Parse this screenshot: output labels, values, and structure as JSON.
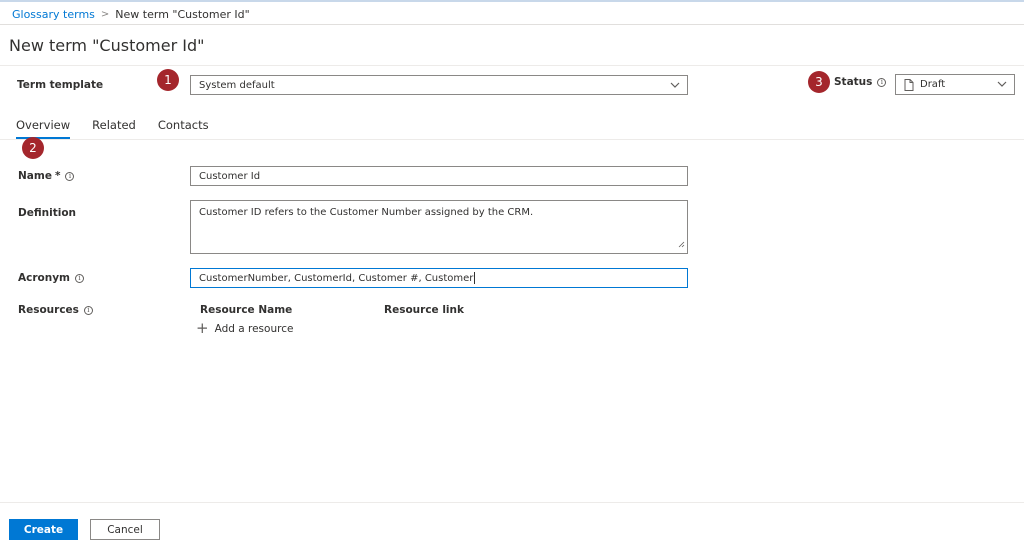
{
  "breadcrumb": {
    "parent": "Glossary terms",
    "current": "New term \"Customer Id\""
  },
  "page": {
    "title": "New term \"Customer Id\""
  },
  "term_template": {
    "label": "Term template",
    "value": "System default"
  },
  "status": {
    "label": "Status",
    "value": "Draft"
  },
  "badges": {
    "one": "1",
    "two": "2",
    "three": "3"
  },
  "tabs": [
    {
      "label": "Overview",
      "active": true
    },
    {
      "label": "Related",
      "active": false
    },
    {
      "label": "Contacts",
      "active": false
    }
  ],
  "form": {
    "name": {
      "label": "Name",
      "required_mark": "*",
      "value": "Customer Id"
    },
    "definition": {
      "label": "Definition",
      "value": "Customer ID refers to the Customer Number assigned by the CRM."
    },
    "acronym": {
      "label": "Acronym",
      "value": "CustomerNumber, CustomerId, Customer #, Customer"
    },
    "resources": {
      "label": "Resources",
      "columns": [
        "Resource Name",
        "Resource link"
      ],
      "add_label": "Add a resource"
    }
  },
  "footer": {
    "create_label": "Create",
    "cancel_label": "Cancel"
  },
  "colors": {
    "accent": "#0078d4",
    "badge": "#a4262c"
  }
}
